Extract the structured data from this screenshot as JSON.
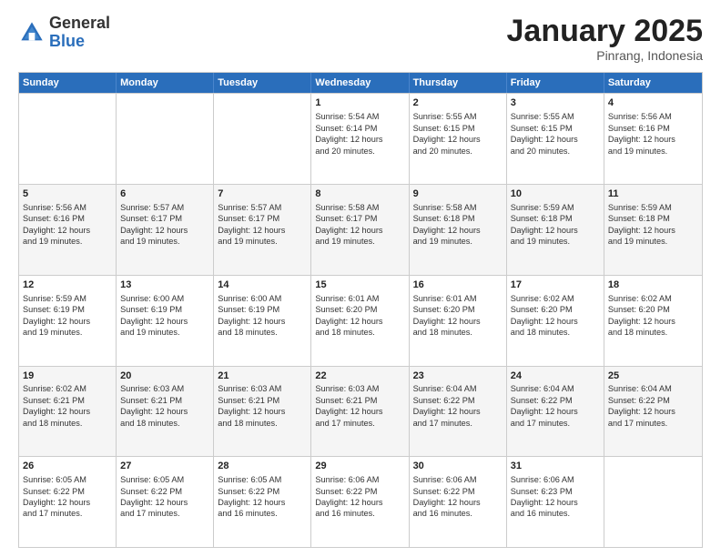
{
  "header": {
    "logo_general": "General",
    "logo_blue": "Blue",
    "month_title": "January 2025",
    "location": "Pinrang, Indonesia"
  },
  "days_of_week": [
    "Sunday",
    "Monday",
    "Tuesday",
    "Wednesday",
    "Thursday",
    "Friday",
    "Saturday"
  ],
  "weeks": [
    {
      "alt": false,
      "days": [
        {
          "num": "",
          "lines": []
        },
        {
          "num": "",
          "lines": []
        },
        {
          "num": "",
          "lines": []
        },
        {
          "num": "1",
          "lines": [
            "Sunrise: 5:54 AM",
            "Sunset: 6:14 PM",
            "Daylight: 12 hours",
            "and 20 minutes."
          ]
        },
        {
          "num": "2",
          "lines": [
            "Sunrise: 5:55 AM",
            "Sunset: 6:15 PM",
            "Daylight: 12 hours",
            "and 20 minutes."
          ]
        },
        {
          "num": "3",
          "lines": [
            "Sunrise: 5:55 AM",
            "Sunset: 6:15 PM",
            "Daylight: 12 hours",
            "and 20 minutes."
          ]
        },
        {
          "num": "4",
          "lines": [
            "Sunrise: 5:56 AM",
            "Sunset: 6:16 PM",
            "Daylight: 12 hours",
            "and 19 minutes."
          ]
        }
      ]
    },
    {
      "alt": true,
      "days": [
        {
          "num": "5",
          "lines": [
            "Sunrise: 5:56 AM",
            "Sunset: 6:16 PM",
            "Daylight: 12 hours",
            "and 19 minutes."
          ]
        },
        {
          "num": "6",
          "lines": [
            "Sunrise: 5:57 AM",
            "Sunset: 6:17 PM",
            "Daylight: 12 hours",
            "and 19 minutes."
          ]
        },
        {
          "num": "7",
          "lines": [
            "Sunrise: 5:57 AM",
            "Sunset: 6:17 PM",
            "Daylight: 12 hours",
            "and 19 minutes."
          ]
        },
        {
          "num": "8",
          "lines": [
            "Sunrise: 5:58 AM",
            "Sunset: 6:17 PM",
            "Daylight: 12 hours",
            "and 19 minutes."
          ]
        },
        {
          "num": "9",
          "lines": [
            "Sunrise: 5:58 AM",
            "Sunset: 6:18 PM",
            "Daylight: 12 hours",
            "and 19 minutes."
          ]
        },
        {
          "num": "10",
          "lines": [
            "Sunrise: 5:59 AM",
            "Sunset: 6:18 PM",
            "Daylight: 12 hours",
            "and 19 minutes."
          ]
        },
        {
          "num": "11",
          "lines": [
            "Sunrise: 5:59 AM",
            "Sunset: 6:18 PM",
            "Daylight: 12 hours",
            "and 19 minutes."
          ]
        }
      ]
    },
    {
      "alt": false,
      "days": [
        {
          "num": "12",
          "lines": [
            "Sunrise: 5:59 AM",
            "Sunset: 6:19 PM",
            "Daylight: 12 hours",
            "and 19 minutes."
          ]
        },
        {
          "num": "13",
          "lines": [
            "Sunrise: 6:00 AM",
            "Sunset: 6:19 PM",
            "Daylight: 12 hours",
            "and 19 minutes."
          ]
        },
        {
          "num": "14",
          "lines": [
            "Sunrise: 6:00 AM",
            "Sunset: 6:19 PM",
            "Daylight: 12 hours",
            "and 18 minutes."
          ]
        },
        {
          "num": "15",
          "lines": [
            "Sunrise: 6:01 AM",
            "Sunset: 6:20 PM",
            "Daylight: 12 hours",
            "and 18 minutes."
          ]
        },
        {
          "num": "16",
          "lines": [
            "Sunrise: 6:01 AM",
            "Sunset: 6:20 PM",
            "Daylight: 12 hours",
            "and 18 minutes."
          ]
        },
        {
          "num": "17",
          "lines": [
            "Sunrise: 6:02 AM",
            "Sunset: 6:20 PM",
            "Daylight: 12 hours",
            "and 18 minutes."
          ]
        },
        {
          "num": "18",
          "lines": [
            "Sunrise: 6:02 AM",
            "Sunset: 6:20 PM",
            "Daylight: 12 hours",
            "and 18 minutes."
          ]
        }
      ]
    },
    {
      "alt": true,
      "days": [
        {
          "num": "19",
          "lines": [
            "Sunrise: 6:02 AM",
            "Sunset: 6:21 PM",
            "Daylight: 12 hours",
            "and 18 minutes."
          ]
        },
        {
          "num": "20",
          "lines": [
            "Sunrise: 6:03 AM",
            "Sunset: 6:21 PM",
            "Daylight: 12 hours",
            "and 18 minutes."
          ]
        },
        {
          "num": "21",
          "lines": [
            "Sunrise: 6:03 AM",
            "Sunset: 6:21 PM",
            "Daylight: 12 hours",
            "and 18 minutes."
          ]
        },
        {
          "num": "22",
          "lines": [
            "Sunrise: 6:03 AM",
            "Sunset: 6:21 PM",
            "Daylight: 12 hours",
            "and 17 minutes."
          ]
        },
        {
          "num": "23",
          "lines": [
            "Sunrise: 6:04 AM",
            "Sunset: 6:22 PM",
            "Daylight: 12 hours",
            "and 17 minutes."
          ]
        },
        {
          "num": "24",
          "lines": [
            "Sunrise: 6:04 AM",
            "Sunset: 6:22 PM",
            "Daylight: 12 hours",
            "and 17 minutes."
          ]
        },
        {
          "num": "25",
          "lines": [
            "Sunrise: 6:04 AM",
            "Sunset: 6:22 PM",
            "Daylight: 12 hours",
            "and 17 minutes."
          ]
        }
      ]
    },
    {
      "alt": false,
      "days": [
        {
          "num": "26",
          "lines": [
            "Sunrise: 6:05 AM",
            "Sunset: 6:22 PM",
            "Daylight: 12 hours",
            "and 17 minutes."
          ]
        },
        {
          "num": "27",
          "lines": [
            "Sunrise: 6:05 AM",
            "Sunset: 6:22 PM",
            "Daylight: 12 hours",
            "and 17 minutes."
          ]
        },
        {
          "num": "28",
          "lines": [
            "Sunrise: 6:05 AM",
            "Sunset: 6:22 PM",
            "Daylight: 12 hours",
            "and 16 minutes."
          ]
        },
        {
          "num": "29",
          "lines": [
            "Sunrise: 6:06 AM",
            "Sunset: 6:22 PM",
            "Daylight: 12 hours",
            "and 16 minutes."
          ]
        },
        {
          "num": "30",
          "lines": [
            "Sunrise: 6:06 AM",
            "Sunset: 6:22 PM",
            "Daylight: 12 hours",
            "and 16 minutes."
          ]
        },
        {
          "num": "31",
          "lines": [
            "Sunrise: 6:06 AM",
            "Sunset: 6:23 PM",
            "Daylight: 12 hours",
            "and 16 minutes."
          ]
        },
        {
          "num": "",
          "lines": []
        }
      ]
    }
  ]
}
